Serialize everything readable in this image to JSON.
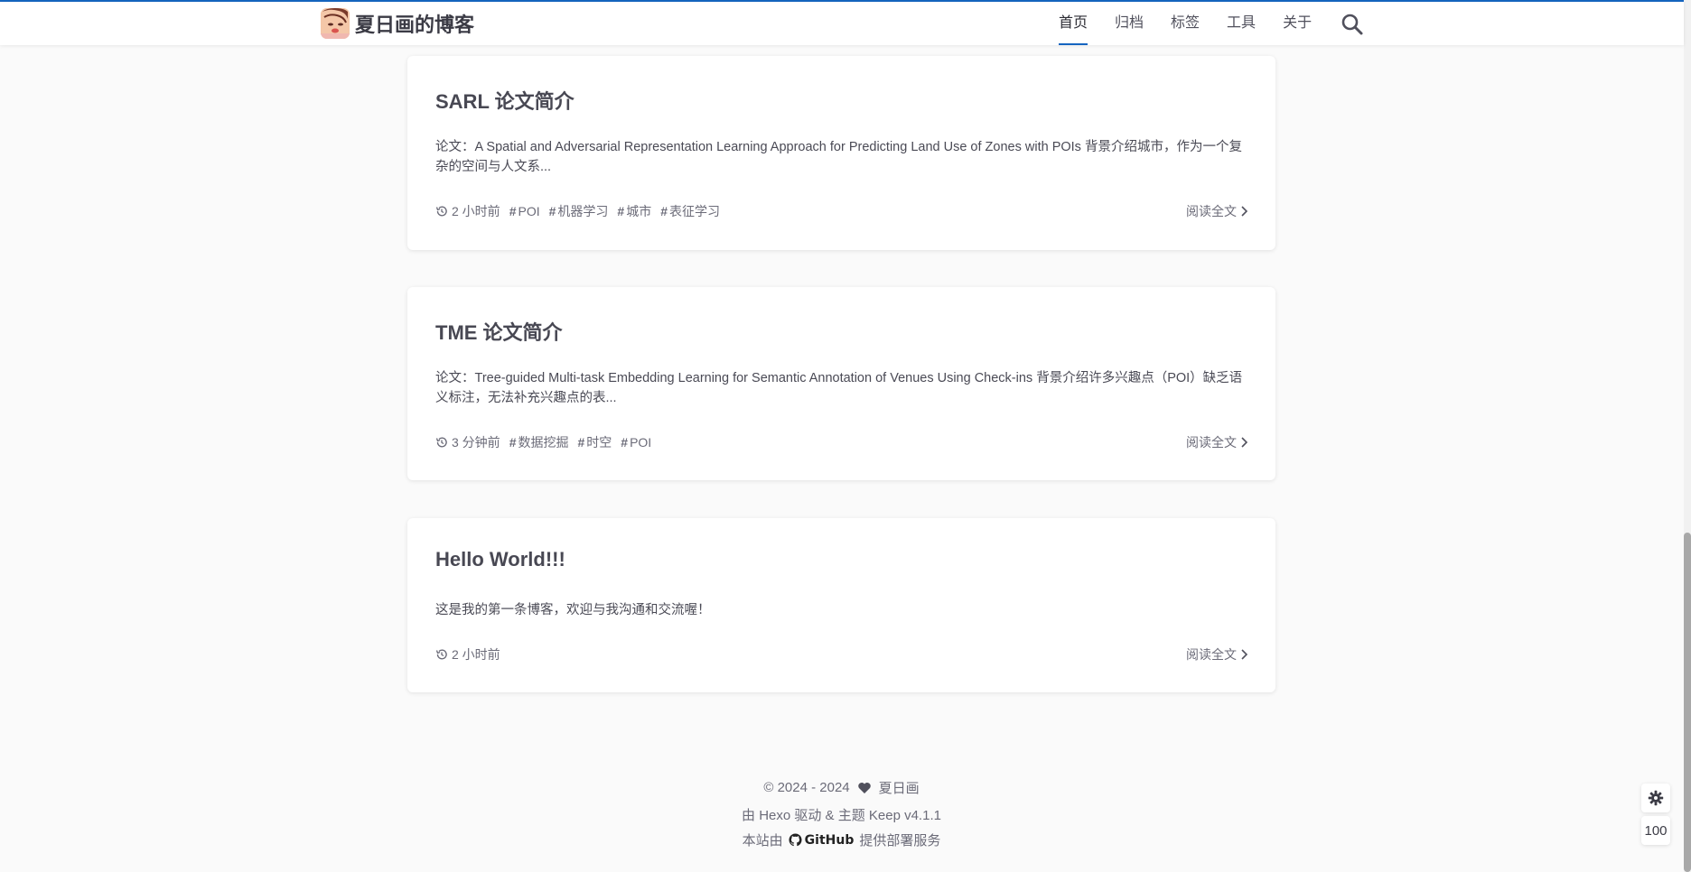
{
  "header": {
    "site_title": "夏日画的博客",
    "nav": [
      {
        "label": "首页",
        "active": true
      },
      {
        "label": "归档",
        "active": false
      },
      {
        "label": "标签",
        "active": false
      },
      {
        "label": "工具",
        "active": false
      },
      {
        "label": "关于",
        "active": false
      }
    ],
    "search_icon": "search-icon",
    "accent": "#1565c0"
  },
  "posts": [
    {
      "title": "SARL 论文简介",
      "excerpt": "论文：A Spatial and Adversarial Representation Learning Approach for Predicting Land Use of Zones with POIs 背景介绍城市，作为一个复杂的空间与人文系...",
      "time": "2 小时前",
      "tags": [
        "POI",
        "机器学习",
        "城市",
        "表征学习"
      ],
      "read_more": "阅读全文"
    },
    {
      "title": "TME 论文简介",
      "excerpt": "论文：Tree-guided Multi-task Embedding Learning for Semantic Annotation of Venues Using Check-ins 背景介绍许多兴趣点（POI）缺乏语义标注，无法补充兴趣点的表...",
      "time": "3 分钟前",
      "tags": [
        "数据挖掘",
        "时空",
        "POI"
      ],
      "read_more": "阅读全文"
    },
    {
      "title": "Hello World!!!",
      "excerpt": "这是我的第一条博客，欢迎与我沟通和交流喔！",
      "time": "2 小时前",
      "tags": [],
      "read_more": "阅读全文"
    }
  ],
  "footer": {
    "copyright": "© 2024 - 2024",
    "author": "夏日画",
    "powered": "由 Hexo 驱动 & 主题 Keep v4.1.1",
    "hosted_prefix": "本站由",
    "hosted_brand": "GitHub",
    "hosted_suffix": "提供部署服务"
  },
  "tools": {
    "settings_icon": "gear-icon",
    "progress_value": "100"
  }
}
